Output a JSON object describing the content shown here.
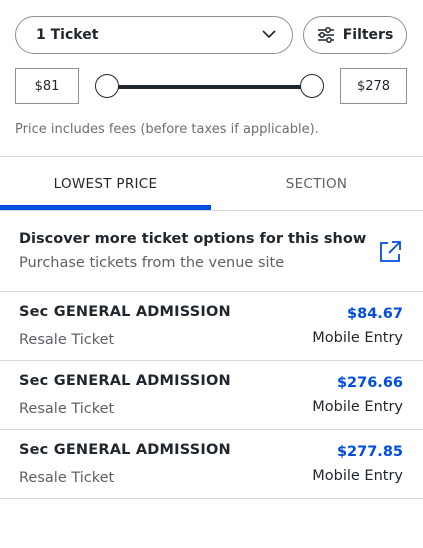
{
  "ticket_select": {
    "value": "1 Ticket",
    "icon": "chevron-down-icon"
  },
  "filters": {
    "label": "Filters",
    "icon": "sliders-icon"
  },
  "price_range": {
    "min_label": "$81",
    "max_label": "$278",
    "min_value": 81,
    "max_value": 278
  },
  "fee_note": "Price includes fees (before taxes if applicable).",
  "tabs": [
    {
      "label": "LOWEST PRICE",
      "selected": true
    },
    {
      "label": "SECTION",
      "selected": false
    }
  ],
  "discover": {
    "title": "Discover more ticket options for this show",
    "subtitle": "Purchase tickets from the venue site",
    "icon": "external-link-icon"
  },
  "listings": [
    {
      "section": "Sec GENERAL ADMISSION",
      "type": "Resale Ticket",
      "price": "$84.67",
      "entry": "Mobile Entry"
    },
    {
      "section": "Sec GENERAL ADMISSION",
      "type": "Resale Ticket",
      "price": "$276.66",
      "entry": "Mobile Entry"
    },
    {
      "section": "Sec GENERAL ADMISSION",
      "type": "Resale Ticket",
      "price": "$277.85",
      "entry": "Mobile Entry"
    }
  ],
  "colors": {
    "accent": "#024ddf",
    "text": "#1f262d",
    "muted": "#5c6166",
    "divider": "#d6d8da"
  }
}
